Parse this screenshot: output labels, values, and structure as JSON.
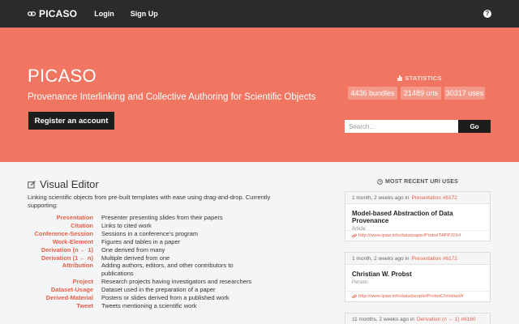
{
  "navbar": {
    "brand": "PICASO",
    "links": [
      "Login",
      "Sign Up"
    ],
    "help_icon": "question-circle-icon"
  },
  "hero": {
    "title": "PICASO",
    "subtitle": "Provenance Interlinking and Collective Authoring for Scientific Objects",
    "register_label": "Register an account",
    "statistics_label": "STATISTICS",
    "stats": [
      "4436 bundles",
      "21489 uris",
      "30317 uses"
    ],
    "search_placeholder": "Search...",
    "go_label": "Go"
  },
  "editor": {
    "title": "Visual Editor",
    "description": "Linking scientific objects from pre-built templates with ease using drag-and-drop. Currently supporting:",
    "items": [
      {
        "key": "Presentation",
        "value": "Presenter presenting slides from their papers"
      },
      {
        "key": "Citation",
        "value": "Links to cited work"
      },
      {
        "key": "Conference-Session",
        "value": "Sessions in a conference's program"
      },
      {
        "key": "Work-Element",
        "value": "Figures and tables in a paper"
      },
      {
        "key": "Derivation (n ← 1)",
        "value": "One derived from many"
      },
      {
        "key": "Derivation (1 ← n)",
        "value": "Multiple derived from one"
      },
      {
        "key": "Attribution",
        "value": "Adding authors, editors, and other contributors to"
      },
      {
        "key": "",
        "value": "publications"
      },
      {
        "key": "Project",
        "value": "Research projects having investigators and researchers"
      },
      {
        "key": "Dataset-Usage",
        "value": "Dataset used in the preparation of a paper"
      },
      {
        "key": "Derived-Material",
        "value": "Posters or slides derived from a published work"
      },
      {
        "key": "Tweet",
        "value": "Tweets mentioning a scientific work"
      }
    ]
  },
  "recent": {
    "heading": "MOST RECENT URI USES",
    "cards": [
      {
        "time": "1 month, 2 weeks ago in",
        "link": "Presentation #6172",
        "title": "Model-based Abstraction of Data Provenance",
        "type": "Article",
        "url": "http://www.ipaw.info/data/paper/ProbstTAPP2014"
      },
      {
        "time": "1 month, 2 weeks ago in",
        "link": "Presentation #6172",
        "title": "Christian W. Probst",
        "type": "Person",
        "url": "http://www.ipaw.info/data/people/ProbstChristianW"
      },
      {
        "time": "11 months, 2 weeks ago in",
        "link": "Derivation (n ← 1) #6160"
      }
    ]
  },
  "colors": {
    "navbar": "#2b2b2b",
    "hero": "#f07662",
    "accent": "#e5604a",
    "button_dark": "#1d1d1d"
  }
}
